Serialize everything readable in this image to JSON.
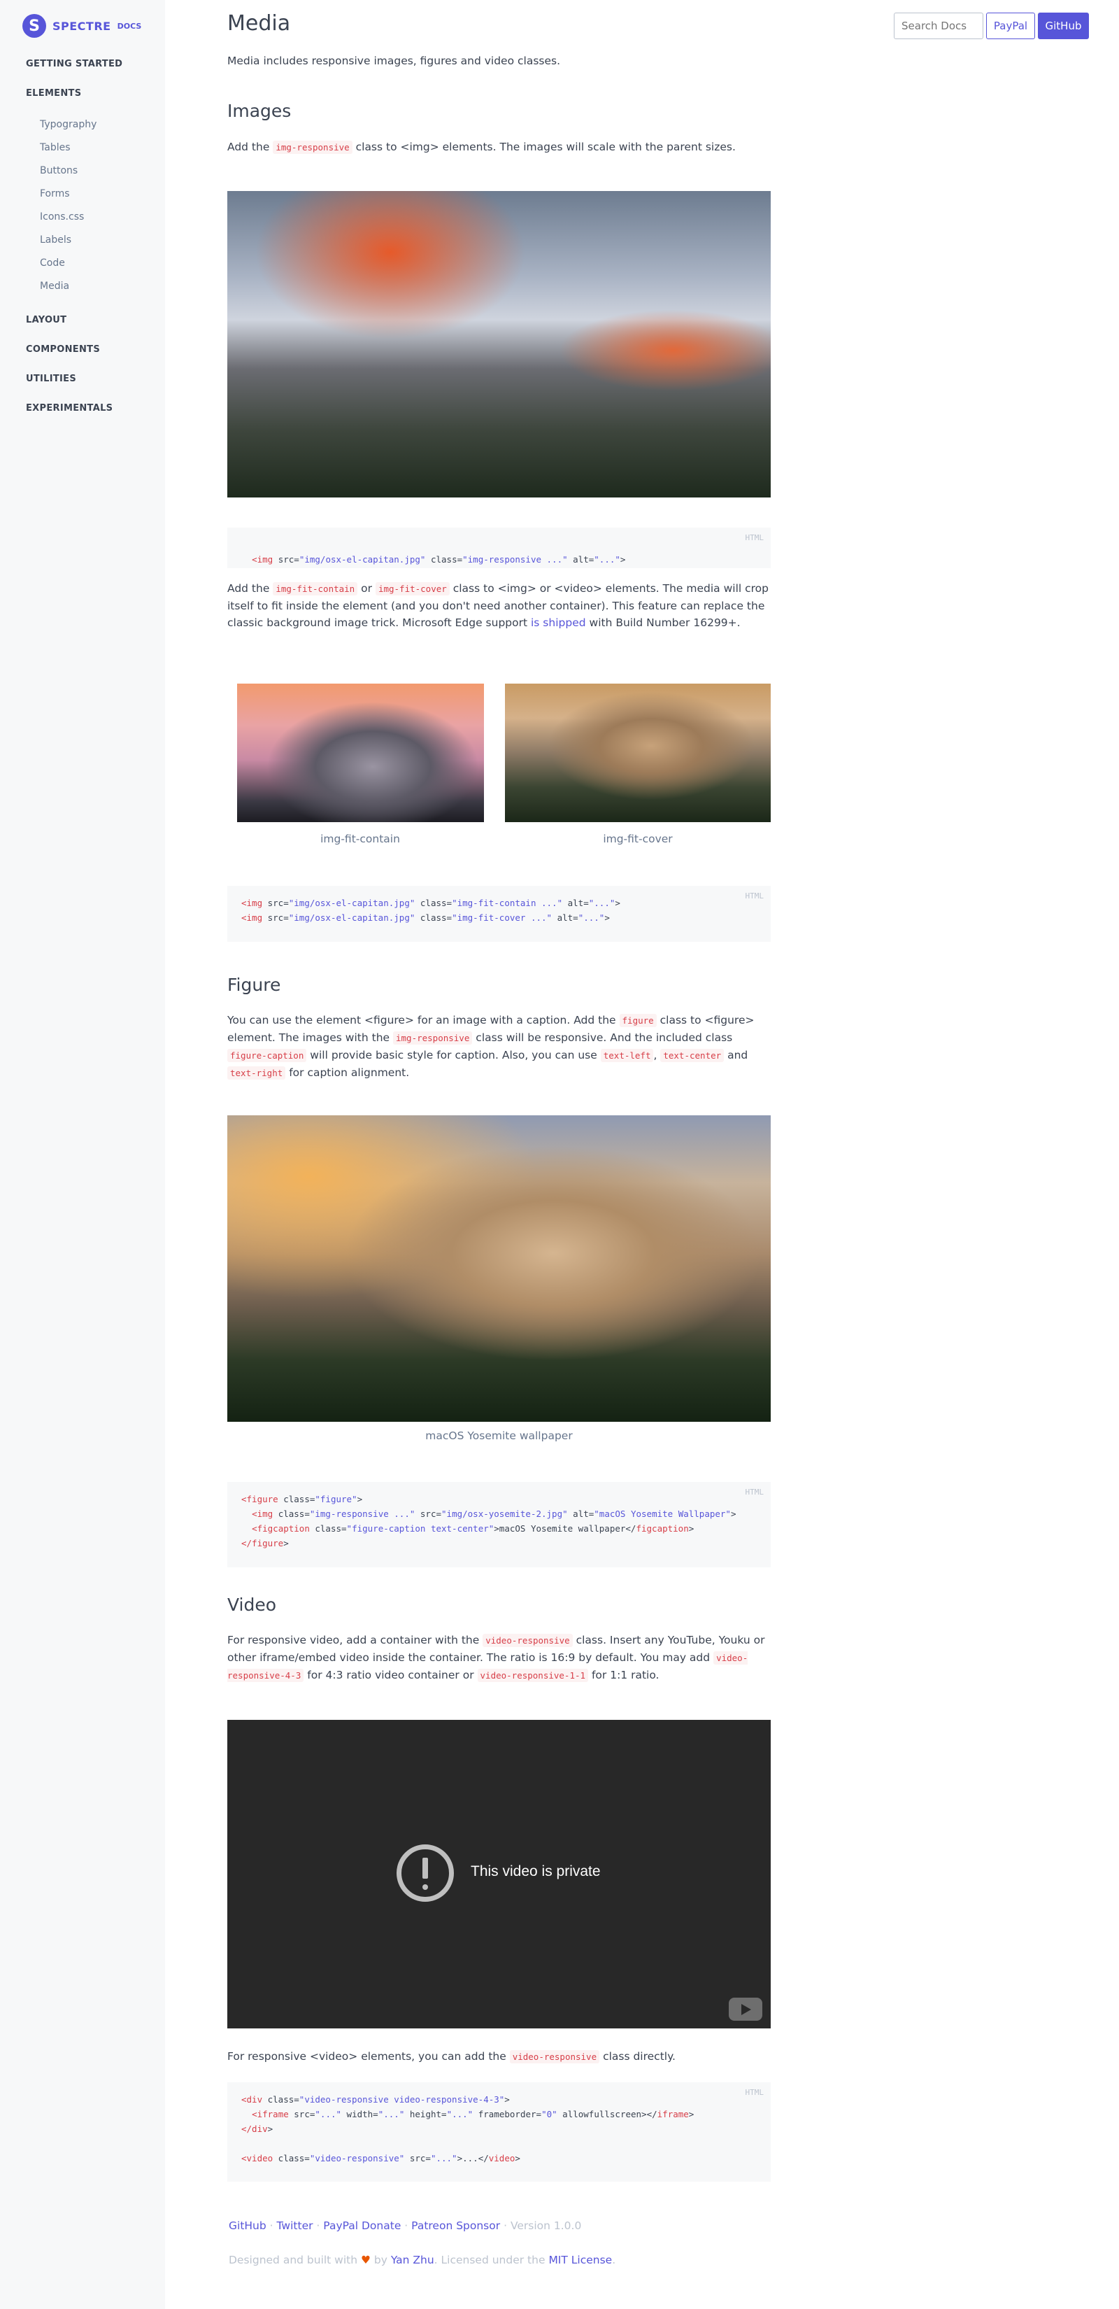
{
  "brand": {
    "logo": "S",
    "name": "SPECTRE",
    "docs": "DOCS"
  },
  "sidebar": {
    "items": [
      {
        "label": "GETTING STARTED"
      },
      {
        "label": "ELEMENTS"
      },
      {
        "label": "Typography"
      },
      {
        "label": "Tables"
      },
      {
        "label": "Buttons"
      },
      {
        "label": "Forms"
      },
      {
        "label": "Icons.css"
      },
      {
        "label": "Labels"
      },
      {
        "label": "Code"
      },
      {
        "label": "Media"
      },
      {
        "label": "LAYOUT"
      },
      {
        "label": "COMPONENTS"
      },
      {
        "label": "UTILITIES"
      },
      {
        "label": "EXPERIMENTALS"
      }
    ]
  },
  "header": {
    "title": "Media",
    "search_placeholder": "Search Docs",
    "paypal": "PayPal",
    "github": "GitHub"
  },
  "intro": "Media includes responsive images, figures and video classes.",
  "images": {
    "heading": "Images",
    "p1_a": "Add the",
    "p1_code": "img-responsive",
    "p1_b": "class to <img> elements. The images will scale with the parent sizes.",
    "code1": {
      "lang": "HTML",
      "t1": "<img",
      "a1": " src=",
      "s1": "\"img/osx-el-capitan.jpg\"",
      "a2": " class=",
      "s2": "\"img-responsive ...\"",
      "a3": " alt=",
      "s3": "\"...\"",
      "t2": ">"
    },
    "p2_a": "Add the",
    "p2_code1": "img-fit-contain",
    "p2_b": "or",
    "p2_code2": "img-fit-cover",
    "p2_c": "class to <img> or <video> elements. The media will crop itself to fit inside the element (and you don't need another container). This feature can replace the classic background image trick. Microsoft Edge support",
    "p2_link": "is shipped",
    "p2_d": "with Build Number 16299+.",
    "caption_contain": "img-fit-contain",
    "caption_cover": "img-fit-cover",
    "code2": {
      "lang": "HTML",
      "l1_tag": "<img",
      "l1_a1": " src=",
      "l1_s1": "\"img/osx-el-capitan.jpg\"",
      "l1_a2": " class=",
      "l1_s2": "\"img-fit-contain ...\"",
      "l1_a3": " alt=",
      "l1_s3": "\"...\"",
      "l1_end": ">",
      "l2_tag": "<img",
      "l2_a1": " src=",
      "l2_s1": "\"img/osx-el-capitan.jpg\"",
      "l2_a2": " class=",
      "l2_s2": "\"img-fit-cover ...\"",
      "l2_a3": " alt=",
      "l2_s3": "\"...\"",
      "l2_end": ">"
    }
  },
  "figure": {
    "heading": "Figure",
    "p_a": "You can use the element <figure> for an image with a caption. Add the",
    "p_code1": "figure",
    "p_b": "class to <figure> element. The images with the",
    "p_code2": "img-responsive",
    "p_c": "class will be responsive. And the included class",
    "p_code3": "figure-caption",
    "p_d": "will provide basic style for caption. Also, you can use",
    "p_code4": "text-left",
    "p_e": ",",
    "p_code5": "text-center",
    "p_f": "and",
    "p_code6": "text-right",
    "p_g": "for caption alignment.",
    "caption": "macOS Yosemite wallpaper",
    "code": {
      "lang": "HTML",
      "l1_tag": "<figure",
      "l1_a": " class=",
      "l1_s": "\"figure\"",
      "l1_end": ">",
      "l2_tag": "<img",
      "l2_a1": " class=",
      "l2_s1": "\"img-responsive ...\"",
      "l2_a2": " src=",
      "l2_s2": "\"img/osx-yosemite-2.jpg\"",
      "l2_a3": " alt=",
      "l2_s3": "\"macOS Yosemite Wallpaper\"",
      "l2_end": ">",
      "l3_tag": "<figcaption",
      "l3_a": " class=",
      "l3_s": "\"figure-caption text-center\"",
      "l3_text": ">macOS Yosemite wallpaper</",
      "l3_close": "figcaption",
      "l3_end": ">",
      "l4_tag": "</figure",
      "l4_end": ">"
    }
  },
  "video": {
    "heading": "Video",
    "p1_a": "For responsive video, add a container with the",
    "p1_code1": "video-responsive",
    "p1_b": "class. Insert any YouTube, Youku or other iframe/embed video inside the container. The ratio is 16:9 by default. You may add",
    "p1_code2": "video-responsive-4-3",
    "p1_c": "for 4:3 ratio video container or",
    "p1_code3": "video-responsive-1-1",
    "p1_d": "for 1:1 ratio.",
    "private_text": "This video is private",
    "p2_a": "For responsive <video> elements, you can add the",
    "p2_code": "video-responsive",
    "p2_b": "class directly.",
    "code": {
      "lang": "HTML",
      "l1_tag": "<div",
      "l1_a": " class=",
      "l1_s": "\"video-responsive video-responsive-4-3\"",
      "l1_end": ">",
      "l2_tag": "<iframe",
      "l2_a1": " src=",
      "l2_s1": "\"...\"",
      "l2_a2": " width=",
      "l2_s2": "\"...\"",
      "l2_a3": " height=",
      "l2_s3": "\"...\"",
      "l2_a4": " frameborder=",
      "l2_s4": "\"0\"",
      "l2_a5": " allowfullscreen></",
      "l2_close": "iframe",
      "l2_end": ">",
      "l3_tag": "</div",
      "l3_end": ">",
      "l4_tag": "<video",
      "l4_a1": " class=",
      "l4_s1": "\"video-responsive\"",
      "l4_a2": " src=",
      "l4_s2": "\"...\"",
      "l4_mid": ">...</",
      "l4_close": "video",
      "l4_end": ">"
    }
  },
  "footer": {
    "github": "GitHub",
    "twitter": "Twitter",
    "paypal": "PayPal Donate",
    "patreon": "Patreon Sponsor",
    "sep": "·",
    "version": "Version 1.0.0",
    "credit_a": "Designed and built with",
    "heart": "♥",
    "credit_b": "by",
    "author": "Yan Zhu",
    "credit_c": ". Licensed under the",
    "license": "MIT License",
    "credit_d": "."
  },
  "colors": {
    "primary": "#5755d9",
    "code": "#d73e48",
    "text": "#3b4351",
    "muted": "#66758c"
  }
}
